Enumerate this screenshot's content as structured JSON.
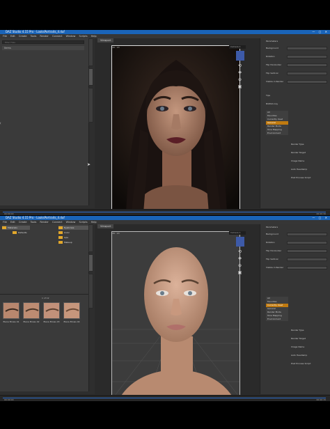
{
  "window": {
    "title": "DAZ Studio 4.15 Pro - LooksPortraits_4.duf",
    "controls": "— ▢ ✕"
  },
  "menubar": [
    "File",
    "Edit",
    "Create",
    "Tools",
    "Render",
    "Connect",
    "Window",
    "Scripts",
    "Help"
  ],
  "viewport": {
    "tab": "Viewport",
    "camera": "Camera 1",
    "frame_label": "16 : 13"
  },
  "screen1": {
    "left_search_placeholder": "Filter Files",
    "left_row": "Items",
    "status_left": "00:00:00",
    "status_right": "00:00:30",
    "right": {
      "tab": "Parameters",
      "rows": [
        "Background",
        "Rotation",
        "Flip Horizontal",
        "Flip Vertical",
        "Visible in Render"
      ],
      "tab2": "Tips",
      "engine": "NVIDIA Iray",
      "list": [
        "All",
        "Favorites",
        "Currently Used",
        "General",
        "Render Mode",
        "Tone Mapping",
        "Environment"
      ],
      "props": [
        "Render Type",
        "Render Target",
        "Image Name",
        "Auto Headlamp",
        "Post Process Script"
      ]
    }
  },
  "screen2": {
    "folders": [
      "Materials",
      "Eyebrows"
    ],
    "subfolders": [
      "Defaults",
      "Color",
      "Lips",
      "Makeup"
    ],
    "results": "1 of 12",
    "thumbs": [
      "Elena Brows 01",
      "Elena Brows 02",
      "Elena Brows 03",
      "Elena Brows 04"
    ],
    "status_left": "00:00:00",
    "status_right": "00:00:15",
    "right": {
      "tab": "Parameters",
      "rows": [
        "Background",
        "Rotation",
        "Flip Horizontal",
        "Flip Vertical",
        "Visible in Render"
      ],
      "list": [
        "All",
        "Favorites",
        "Currently Used",
        "General",
        "Render Mode",
        "Tone Mapping",
        "Environment"
      ],
      "props": [
        "Render Type",
        "Render Target",
        "Image Name",
        "Auto Headlamp",
        "Post Process Script"
      ]
    }
  },
  "colors": {
    "accent": "#1a64b8",
    "selection": "#c07a10",
    "folder": "#e2a72b"
  }
}
